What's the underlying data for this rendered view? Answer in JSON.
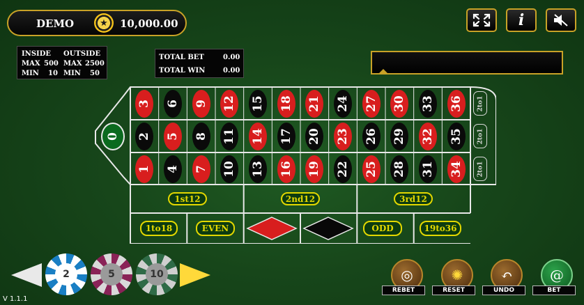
{
  "header": {
    "mode": "DEMO",
    "balance": "10,000.00",
    "coin_icon": "star-coin-icon"
  },
  "limits": {
    "inside_label": "INSIDE",
    "outside_label": "OUTSIDE",
    "max_label": "MAX",
    "min_label": "MIN",
    "inside_max": "500",
    "inside_min": "10",
    "outside_max": "2500",
    "outside_min": "50"
  },
  "totals": {
    "total_bet_label": "TOTAL BET",
    "total_bet": "0.00",
    "total_win_label": "TOTAL WIN",
    "total_win": "0.00"
  },
  "top_buttons": [
    {
      "icon": "fullscreen-icon"
    },
    {
      "icon": "info-icon",
      "glyph": "i"
    },
    {
      "icon": "sound-icon"
    }
  ],
  "table": {
    "zero": "0",
    "rows": [
      [
        {
          "n": "3",
          "c": "red"
        },
        {
          "n": "6",
          "c": "black"
        },
        {
          "n": "9",
          "c": "red"
        },
        {
          "n": "12",
          "c": "red"
        },
        {
          "n": "15",
          "c": "black"
        },
        {
          "n": "18",
          "c": "red"
        },
        {
          "n": "21",
          "c": "red"
        },
        {
          "n": "24",
          "c": "black"
        },
        {
          "n": "27",
          "c": "red"
        },
        {
          "n": "30",
          "c": "red"
        },
        {
          "n": "33",
          "c": "black"
        },
        {
          "n": "36",
          "c": "red"
        }
      ],
      [
        {
          "n": "2",
          "c": "black"
        },
        {
          "n": "5",
          "c": "red"
        },
        {
          "n": "8",
          "c": "black"
        },
        {
          "n": "11",
          "c": "black"
        },
        {
          "n": "14",
          "c": "red"
        },
        {
          "n": "17",
          "c": "black"
        },
        {
          "n": "20",
          "c": "black"
        },
        {
          "n": "23",
          "c": "red"
        },
        {
          "n": "26",
          "c": "black"
        },
        {
          "n": "29",
          "c": "black"
        },
        {
          "n": "32",
          "c": "red"
        },
        {
          "n": "35",
          "c": "black"
        }
      ],
      [
        {
          "n": "1",
          "c": "red"
        },
        {
          "n": "4",
          "c": "black"
        },
        {
          "n": "7",
          "c": "red"
        },
        {
          "n": "10",
          "c": "black"
        },
        {
          "n": "13",
          "c": "black"
        },
        {
          "n": "16",
          "c": "red"
        },
        {
          "n": "19",
          "c": "red"
        },
        {
          "n": "22",
          "c": "black"
        },
        {
          "n": "25",
          "c": "red"
        },
        {
          "n": "28",
          "c": "black"
        },
        {
          "n": "31",
          "c": "black"
        },
        {
          "n": "34",
          "c": "red"
        }
      ]
    ],
    "column_bet": "2to1",
    "dozens": [
      "1st12",
      "2nd12",
      "3rd12"
    ],
    "outside": [
      "1to18",
      "EVEN",
      "",
      "",
      "ODD",
      "19to36"
    ]
  },
  "colors": {
    "gold": "#c9a227",
    "felt": "#17461a",
    "red": "#d81e1e",
    "black": "#0a0a0a",
    "label_yellow": "#e3d800"
  },
  "chips": [
    {
      "value": "2",
      "color": "#1a7fc4"
    },
    {
      "value": "5",
      "color": "#8a2357"
    },
    {
      "value": "10",
      "color": "#2f6b47"
    }
  ],
  "actions": [
    {
      "label": "REBET",
      "icon": "rebet-chips-icon"
    },
    {
      "label": "RESET",
      "icon": "reset-sparkle-icon"
    },
    {
      "label": "UNDO",
      "icon": "undo-arrow-icon"
    },
    {
      "label": "BET",
      "icon": "bet-spiral-icon"
    }
  ],
  "version": "V 1.1.1"
}
